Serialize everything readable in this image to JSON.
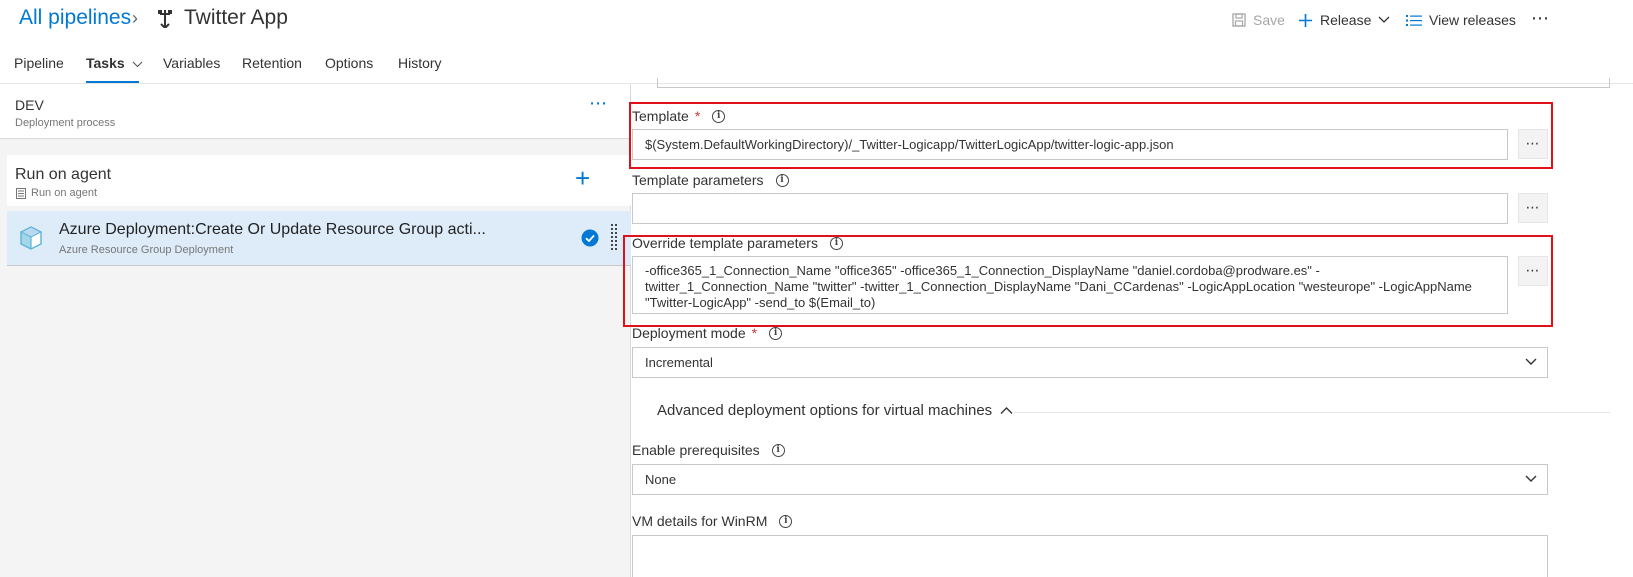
{
  "header": {
    "breadcrumb_root": "All pipelines",
    "app_title": "Twitter App",
    "save_label": "Save",
    "release_label": "Release",
    "view_releases_label": "View releases"
  },
  "tabs": [
    {
      "label": "Pipeline"
    },
    {
      "label": "Tasks"
    },
    {
      "label": "Variables"
    },
    {
      "label": "Retention"
    },
    {
      "label": "Options"
    },
    {
      "label": "History"
    }
  ],
  "left_pane": {
    "stage_name": "DEV",
    "stage_subtitle": "Deployment process",
    "agent_name": "Run on agent",
    "agent_subtitle": "Run on agent",
    "task_name": "Azure Deployment:Create Or Update Resource Group acti...",
    "task_subtitle": "Azure Resource Group Deployment"
  },
  "form": {
    "template_label": "Template",
    "template_required": "*",
    "template_value": "$(System.DefaultWorkingDirectory)/_Twitter-Logicapp/TwitterLogicApp/twitter-logic-app.json",
    "template_params_label": "Template parameters",
    "template_params_value": "",
    "override_label": "Override template parameters",
    "override_line1": "-office365_1_Connection_Name \"office365\" -office365_1_Connection_DisplayName \"daniel.cordoba@prodware.es\" -",
    "override_line2": "twitter_1_Connection_Name \"twitter\" -twitter_1_Connection_DisplayName \"Dani_CCardenas\" -LogicAppLocation \"westeurope\" -LogicAppName",
    "override_line3": "\"Twitter-LogicApp\" -send_to $(Email_to)",
    "deployment_mode_label": "Deployment mode",
    "deployment_mode_required": "*",
    "deployment_mode_value": "Incremental",
    "advanced_section_title": "Advanced deployment options for virtual machines",
    "enable_prereq_label": "Enable prerequisites",
    "enable_prereq_value": "None",
    "vm_winrm_label": "VM details for WinRM",
    "vm_winrm_value": ""
  },
  "colors": {
    "accent": "#0078d4",
    "highlight_border": "#e0111a",
    "selected_task_bg": "#deecf9"
  }
}
